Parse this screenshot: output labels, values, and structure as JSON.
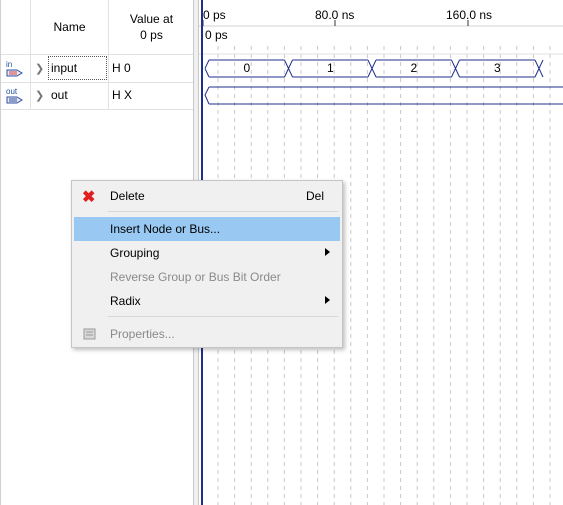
{
  "table": {
    "header_name": "Name",
    "header_value_line1": "Value at",
    "header_value_line2": "0 ps",
    "rows": [
      {
        "icon": "input-port-icon",
        "icon_text": "in",
        "name": "input",
        "value": "H 0"
      },
      {
        "icon": "output-port-icon",
        "icon_text": "out",
        "name": "out",
        "value": "H X"
      }
    ]
  },
  "timeline": {
    "labels": [
      "0 ps",
      "80.0 ns",
      "160.0 ns"
    ],
    "cursor_label": "0 ps"
  },
  "waveform": {
    "input_values": [
      "0",
      "1",
      "2",
      "3"
    ]
  },
  "context_menu": {
    "delete": {
      "label": "Delete",
      "shortcut": "Del",
      "icon": "delete-x-icon"
    },
    "insert": {
      "label": "Insert Node or Bus..."
    },
    "grouping": {
      "label": "Grouping"
    },
    "reverse": {
      "label": "Reverse Group or Bus Bit Order"
    },
    "radix": {
      "label": "Radix"
    },
    "properties": {
      "label": "Properties...",
      "icon": "properties-icon"
    }
  },
  "colors": {
    "cursor": "#1f2f8f",
    "waveform_line": "#1f2f8f",
    "menu_highlight": "#99c9f2"
  }
}
